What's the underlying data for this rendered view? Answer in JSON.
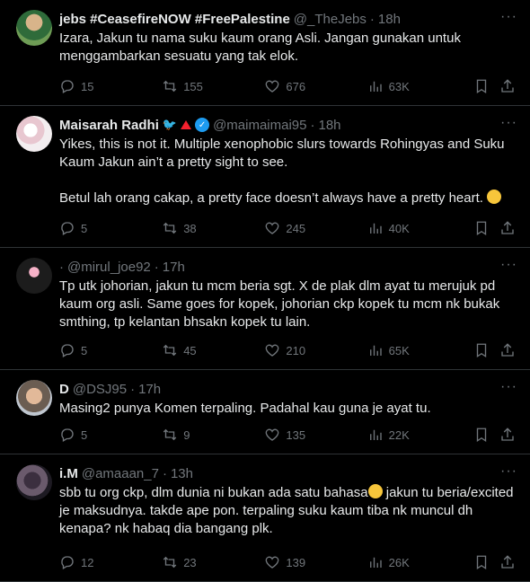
{
  "tweets": [
    {
      "name": "jebs #CeasefireNOW #FreePalestine",
      "handle": "@_TheJebs",
      "time": "18h",
      "text": "Izara, Jakun tu nama suku kaum orang Asli. Jangan gunakan untuk menggambarkan sesuatu yang tak elok.",
      "replies": "15",
      "reposts": "155",
      "likes": "676",
      "views": "63K"
    },
    {
      "name": "Maisarah Radhi",
      "handle": "@maimaimai95",
      "time": "18h",
      "text": "Yikes, this is not it. Multiple xenophobic slurs towards Rohingyas and Suku Kaum Jakun ain’t a pretty sight to see.",
      "text2": "Betul lah orang cakap, a pretty face doesn’t always have a pretty heart.",
      "replies": "5",
      "reposts": "38",
      "likes": "245",
      "views": "40K"
    },
    {
      "name": "",
      "handle": "@mirul_joe92",
      "time": "17h",
      "text": "Tp utk johorian, jakun tu mcm beria sgt. X de plak dlm ayat tu merujuk pd kaum org asli. Same goes for kopek, johorian ckp kopek tu mcm nk bukak smthing, tp kelantan bhsakn kopek tu lain.",
      "replies": "5",
      "reposts": "45",
      "likes": "210",
      "views": "65K"
    },
    {
      "name": "D",
      "handle": "@DSJ95",
      "time": "17h",
      "text": "Masing2 punya Komen terpaling. Padahal kau guna je ayat tu.",
      "replies": "5",
      "reposts": "9",
      "likes": "135",
      "views": "22K"
    },
    {
      "name": "i.M",
      "handle": "@amaaan_7",
      "time": "13h",
      "text_a": "sbb tu org ckp, dlm dunia ni bukan ada satu bahasa",
      "text_b": " jakun tu beria/excited je maksudnya. takde ape pon. terpaling suku kaum tiba nk muncul dh kenapa? nk habaq dia bangang plk.",
      "replies": "12",
      "reposts": "23",
      "likes": "139",
      "views": "26K"
    }
  ],
  "icons": {
    "more": "more-icon",
    "reply": "reply-icon",
    "repost": "repost-icon",
    "like": "heart-icon",
    "views": "views-icon",
    "bookmark": "bookmark-icon",
    "share": "share-icon"
  },
  "colors": {
    "background": "#000000",
    "text": "#e7e9ea",
    "muted": "#71767b",
    "divider": "#2f3336",
    "verified": "#1d9bf0"
  }
}
